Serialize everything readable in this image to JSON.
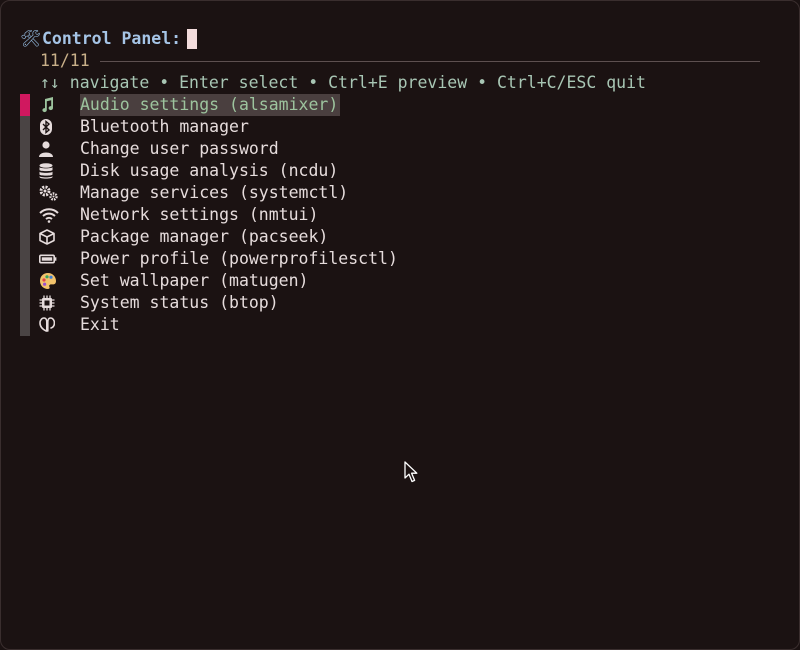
{
  "prompt": {
    "icon": "tools-icon",
    "label": "Control Panel:"
  },
  "counter": "11/11",
  "help": "↑↓ navigate • Enter select • Ctrl+E preview • Ctrl+C/ESC quit",
  "selected_index": 0,
  "colors": {
    "background": "#1b1212",
    "selection_marker": "#d0185f",
    "selected_text": "#9dc49e",
    "prompt": "#a5c4e6",
    "counter": "#c9b089",
    "help": "#a8c6b4"
  },
  "items": [
    {
      "icon": "music-note-icon",
      "label": "Audio settings (alsamixer)"
    },
    {
      "icon": "bluetooth-icon",
      "label": "Bluetooth manager"
    },
    {
      "icon": "user-icon",
      "label": "Change user password"
    },
    {
      "icon": "database-icon",
      "label": "Disk usage analysis (ncdu)"
    },
    {
      "icon": "gears-icon",
      "label": "Manage services (systemctl)"
    },
    {
      "icon": "wifi-icon",
      "label": "Network settings (nmtui)"
    },
    {
      "icon": "package-icon",
      "label": "Package manager (pacseek)"
    },
    {
      "icon": "battery-icon",
      "label": "Power profile (powerprofilesctl)"
    },
    {
      "icon": "palette-icon",
      "label": "Set wallpaper (matugen)"
    },
    {
      "icon": "cpu-chip-icon",
      "label": "System status (btop)"
    },
    {
      "icon": "exit-icon",
      "label": "Exit"
    }
  ]
}
